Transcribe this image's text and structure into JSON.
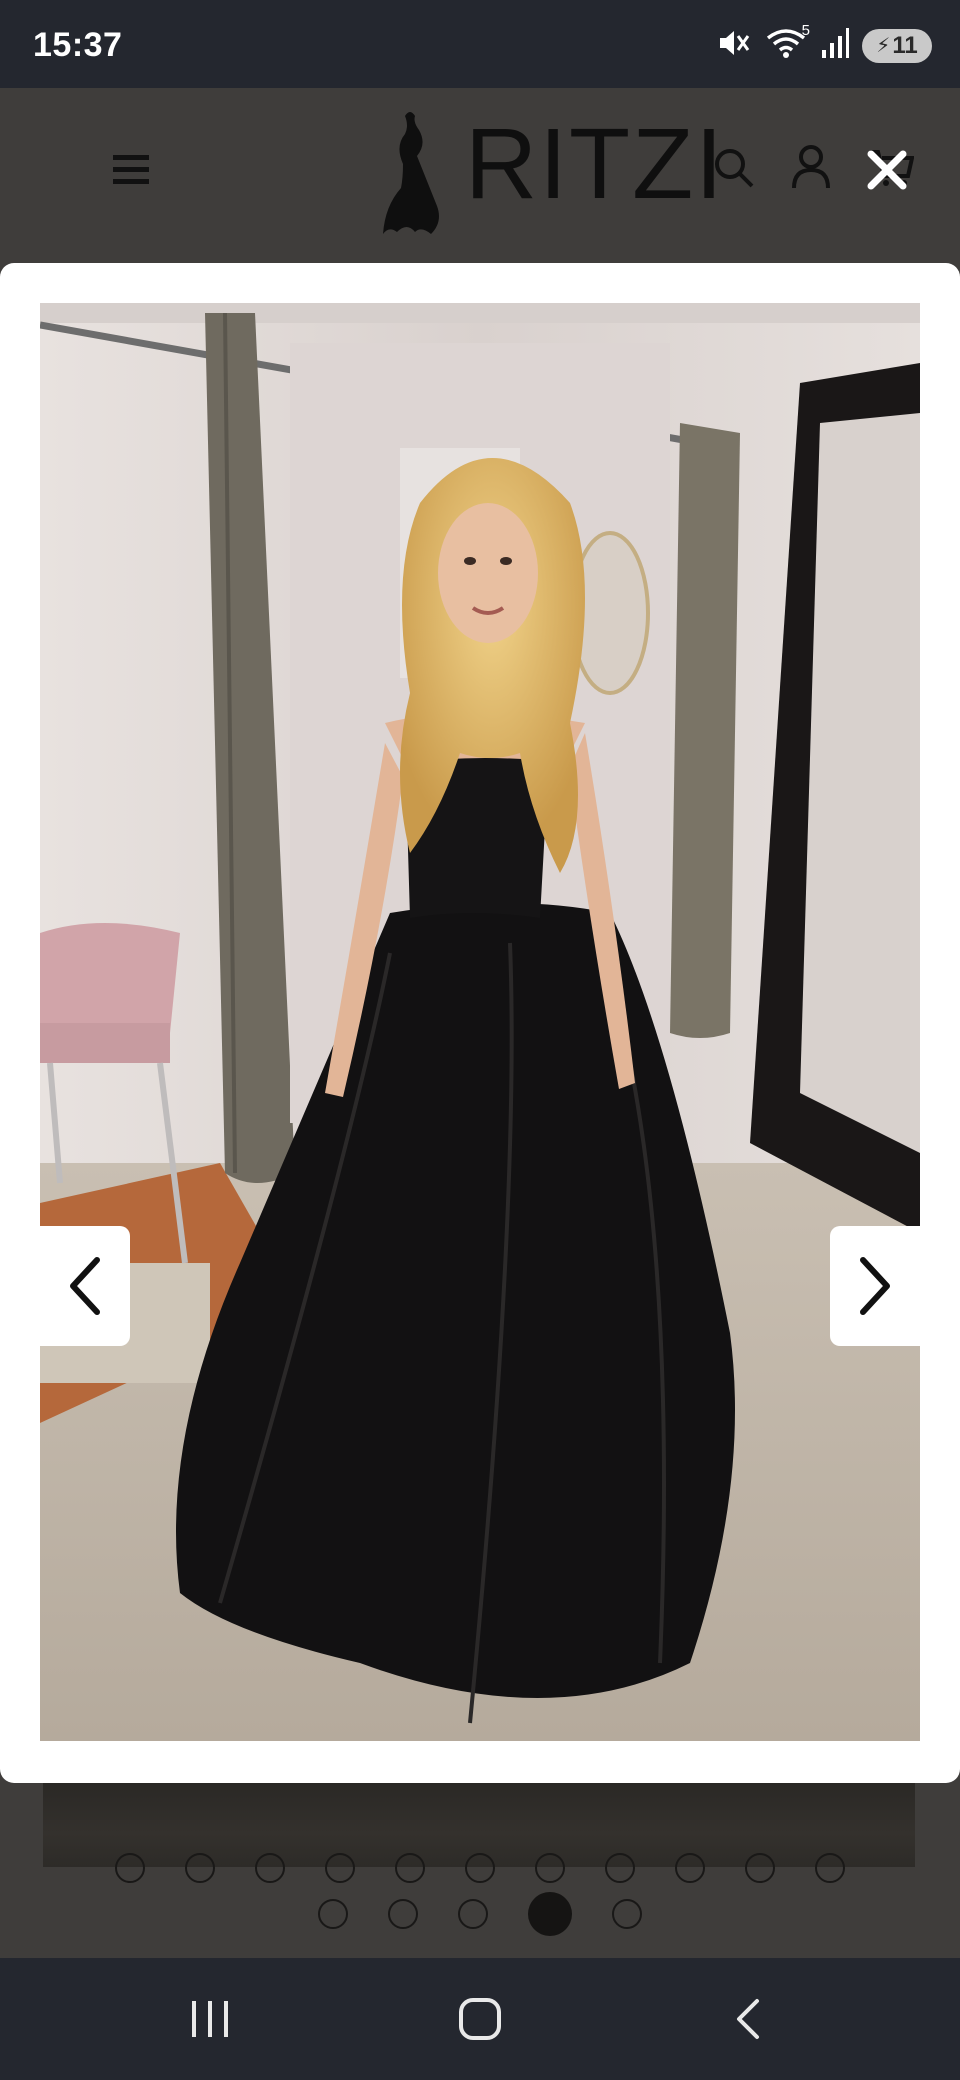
{
  "status_bar": {
    "time": "15:37",
    "icons": [
      "mute-icon",
      "wifi-icon",
      "signal-icon",
      "battery-icon"
    ],
    "wifi_badge": "5",
    "battery_level": "11"
  },
  "header": {
    "brand": "RITZI",
    "icons": [
      "menu-icon",
      "search-icon",
      "account-icon",
      "cart-icon"
    ]
  },
  "lightbox": {
    "image_alt": "Model in black strapless tulle ball gown with lace bodice",
    "close_icon": "close-icon",
    "prev_icon": "chevron-left-icon",
    "next_icon": "chevron-right-icon"
  },
  "carousel": {
    "row1_count": 11,
    "row2_count": 5,
    "active_index": 14
  },
  "system_nav": {
    "buttons": [
      "recent-apps-icon",
      "home-icon",
      "back-icon"
    ]
  },
  "colors": {
    "status_bar_bg": "#24272f",
    "overlay_bg": "#3f3d3b",
    "modal_bg": "#ffffff",
    "dress": "#111111",
    "accent": "#ffffff"
  }
}
